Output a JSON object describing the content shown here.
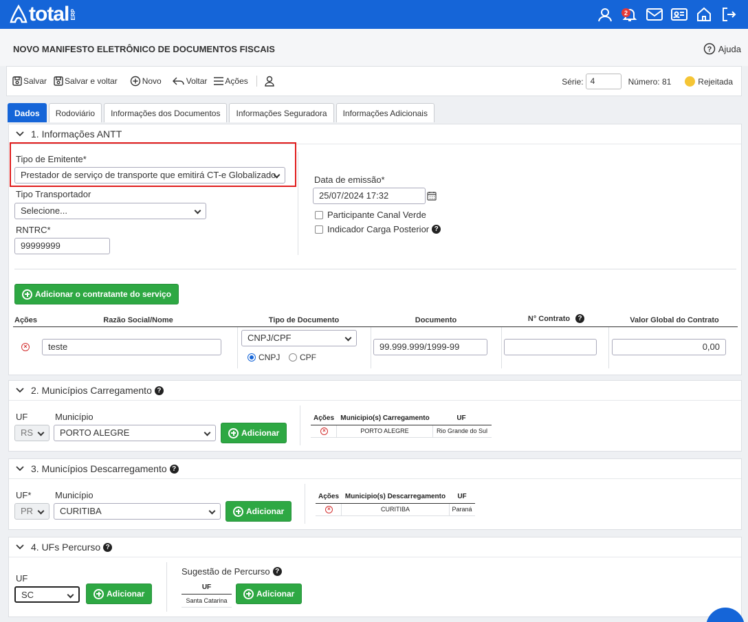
{
  "app": {
    "logo_text": "total",
    "logo_sub": "ERP",
    "notif_count": "2"
  },
  "page": {
    "title": "NOVO MANIFESTO ELETRÔNICO DE DOCUMENTOS FISCAIS",
    "help": "Ajuda"
  },
  "toolbar": {
    "salvar": "Salvar",
    "salvar_voltar": "Salvar e voltar",
    "novo": "Novo",
    "voltar": "Voltar",
    "acoes": "Ações",
    "serie_label": "Série:",
    "serie_value": "4",
    "numero_label": "Número: 81",
    "status": "Rejeitada",
    "status_color": "#f5c535"
  },
  "tabs": [
    "Dados",
    "Rodoviário",
    "Informações dos Documentos",
    "Informações Seguradora",
    "Informações Adicionais"
  ],
  "antt": {
    "title": "1. Informações ANTT",
    "tipo_emitente_label": "Tipo de Emitente*",
    "tipo_emitente_value": "Prestador de serviço de transporte que emitirá CT-e Globalizado.",
    "tipo_transportador_label": "Tipo Transportador",
    "tipo_transportador_value": "Selecione...",
    "rntrc_label": "RNTRC*",
    "rntrc_value": "99999999",
    "data_label": "Data de emissão*",
    "data_value": "25/07/2024 17:32",
    "canal_verde": "Participante Canal Verde",
    "carga_posterior": "Indicador Carga Posterior",
    "add_contratante": "Adicionar o contratante do serviço",
    "cols": {
      "acoes": "Ações",
      "razao": "Razão Social/Nome",
      "tipo_doc": "Tipo de Documento",
      "documento": "Documento",
      "contrato": "N° Contrato",
      "valor": "Valor Global do Contrato"
    },
    "row": {
      "razao": "teste",
      "tipo_doc": "CNPJ/CPF",
      "radio_cnpj": "CNPJ",
      "radio_cpf": "CPF",
      "documento": "99.999.999/1999-99",
      "contrato": "",
      "valor": "0,00"
    }
  },
  "carregamento": {
    "title": "2. Municípios Carregamento",
    "uf_label": "UF",
    "uf_value": "RS",
    "mun_label": "Município",
    "mun_value": "PORTO ALEGRE",
    "add": "Adicionar",
    "cols": {
      "acoes": "Ações",
      "mun": "Municipio(s) Carregamento",
      "uf": "UF"
    },
    "row": {
      "mun": "PORTO ALEGRE",
      "uf": "Rio Grande do Sul"
    }
  },
  "descarregamento": {
    "title": "3. Municípios Descarregamento",
    "uf_label": "UF*",
    "uf_value": "PR",
    "mun_label": "Município",
    "mun_value": "CURITIBA",
    "add": "Adicionar",
    "cols": {
      "acoes": "Ações",
      "mun": "Municipio(s) Descarregamento",
      "uf": "UF"
    },
    "row": {
      "mun": "CURITIBA",
      "uf": "Paraná"
    }
  },
  "percurso": {
    "title": "4. UFs Percurso",
    "uf_label": "UF",
    "uf_value": "SC",
    "add": "Adicionar",
    "sugestao_label": "Sugestão de Percurso",
    "sug_col": "UF",
    "sug_row": "Santa Catarina",
    "sug_add": "Adicionar"
  }
}
